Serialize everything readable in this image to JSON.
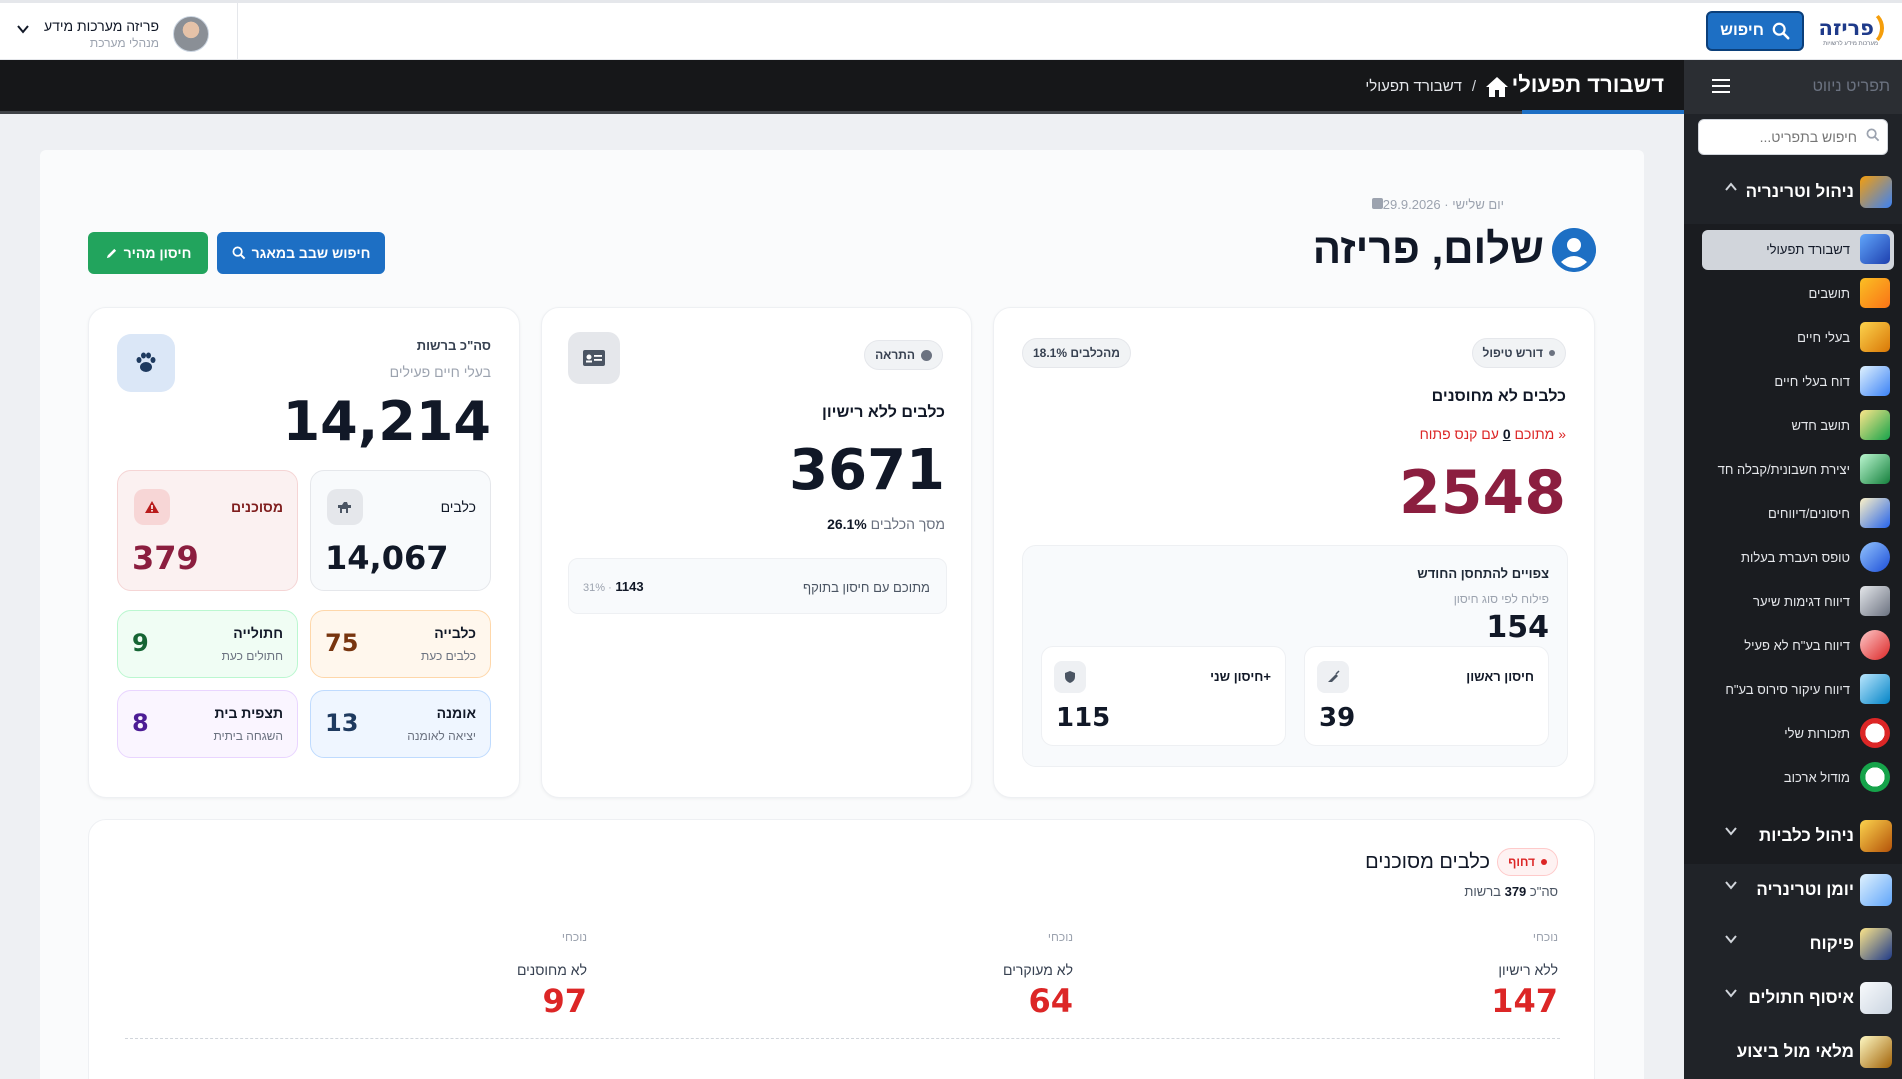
{
  "topbar": {
    "logo_text": "פריזה",
    "logo_sub": "מערכות מידע לרשויות",
    "search_label": "חיפוש",
    "user_name": "פריזה מערכות מידע",
    "user_role": "מנהלי מערכת"
  },
  "pagebar": {
    "title": "דשבורד תפעולי",
    "breadcrumb": "דשבורד תפעולי",
    "breadcrumb_sep": "/"
  },
  "sidebar": {
    "title": "תפריט ניווט",
    "search_placeholder": "חיפוש בתפריט...",
    "sections": [
      {
        "label": "ניהול וטרינריה",
        "icon": "folder-box-icon",
        "expanded": true
      },
      {
        "label": "ניהול כלביות",
        "icon": "dog-icon",
        "expanded": false
      },
      {
        "label": "יומן וטרינריה",
        "icon": "documents-icon",
        "expanded": false
      },
      {
        "label": "פיקוח",
        "icon": "inspector-icon",
        "expanded": false
      },
      {
        "label": "איסוף חתולים",
        "icon": "cat-icon",
        "expanded": false
      },
      {
        "label": "מלאי מול ביצוע",
        "icon": "notepad-icon",
        "expanded": false
      }
    ],
    "items": [
      {
        "label": "דשבורד תפעולי",
        "icon": "monitor-icon",
        "active": true
      },
      {
        "label": "תושבים",
        "icon": "residents-icon"
      },
      {
        "label": "בעלי חיים",
        "icon": "dog-icon"
      },
      {
        "label": "דוח בעלי חיים",
        "icon": "report-icon"
      },
      {
        "label": "תושב חדש",
        "icon": "add-user-icon"
      },
      {
        "label": "יצירת חשבונית/קבלה חד",
        "icon": "invoice-icon"
      },
      {
        "label": "חיסונים/דיווחים",
        "icon": "magnifier-icon"
      },
      {
        "label": "טופס העברת בעלות",
        "icon": "refresh-icon"
      },
      {
        "label": "דיווח דגימות שיער",
        "icon": "scissors-icon"
      },
      {
        "label": "דיווח בע\"ח לא פעיל",
        "icon": "collar-icon"
      },
      {
        "label": "דיווח עיקור סירוס בע\"ח",
        "icon": "clipboard-icon"
      },
      {
        "label": "תזכורות שלי",
        "icon": "alarm-icon"
      },
      {
        "label": "מודול ארכוב",
        "icon": "archive-clock-icon"
      }
    ]
  },
  "header": {
    "date": "יום שלישי · 29.9.2026",
    "greeting": "שלום, פריזה",
    "btn_quick_vaccine": "חיסון מהיר",
    "btn_search_db": "חיפוש שבב במאגר"
  },
  "card_unvaccinated": {
    "badge": "דורש טיפול",
    "share_pill": "18.1% מהכלבים",
    "title": "כלבים לא מחוסנים",
    "fine_prefix": "מתוכם",
    "fine_count": "0",
    "fine_suffix": "עם קנס פתוח »",
    "value": "2548",
    "expected_title": "צפויים להתחסן החודש",
    "expected_sub": "פילוח לפי סוג חיסון",
    "expected_value": "154",
    "first_label": "חיסון ראשון",
    "first_value": "39",
    "second_label": "חיסון שני+",
    "second_value": "115"
  },
  "card_unlicensed": {
    "badge": "התראה",
    "title": "כלבים ללא רישיון",
    "value": "3671",
    "pct": "26.1%",
    "pct_label": "מסך הכלבים",
    "sub_label": "מתוכם עם חיסון בתוקף",
    "sub_value": "1143",
    "sub_pct": "31% ·"
  },
  "card_total": {
    "title": "סה\"כ ברשות",
    "subtitle": "בעלי חיים פעילים",
    "value": "14,214",
    "tiles": [
      {
        "title": "כלבים",
        "value": "14,067"
      },
      {
        "title": "מסוכנים",
        "value": "379"
      },
      {
        "title": "כלבייה",
        "sub": "כלבים כעת",
        "value": "75"
      },
      {
        "title": "חתולייה",
        "sub": "חתולים כעת",
        "value": "9"
      },
      {
        "title": "אומנה",
        "sub": "יציאה לאומנה",
        "value": "13"
      },
      {
        "title": "תצפית בית",
        "sub": "השגחה ביתית",
        "value": "8"
      }
    ]
  },
  "dangerous": {
    "urgent": "דחוף",
    "title": "כלבים מסוכנים",
    "total_prefix": "סה\"כ",
    "total_value": "379",
    "total_suffix": "ברשות",
    "stats": [
      {
        "small": "נוכחי",
        "label": "ללא רישיון",
        "value": "147"
      },
      {
        "small": "נוכחי",
        "label": "לא מעוקרים",
        "value": "64"
      },
      {
        "small": "נוכחי",
        "label": "לא מחוסנים",
        "value": "97"
      }
    ]
  },
  "colors": {
    "primary": "#1d6fc4",
    "success": "#22a45d",
    "danger": "#dc2626",
    "maroon": "#8b1e3f",
    "dark_bar": "#161719",
    "sidebar": "#202328"
  }
}
